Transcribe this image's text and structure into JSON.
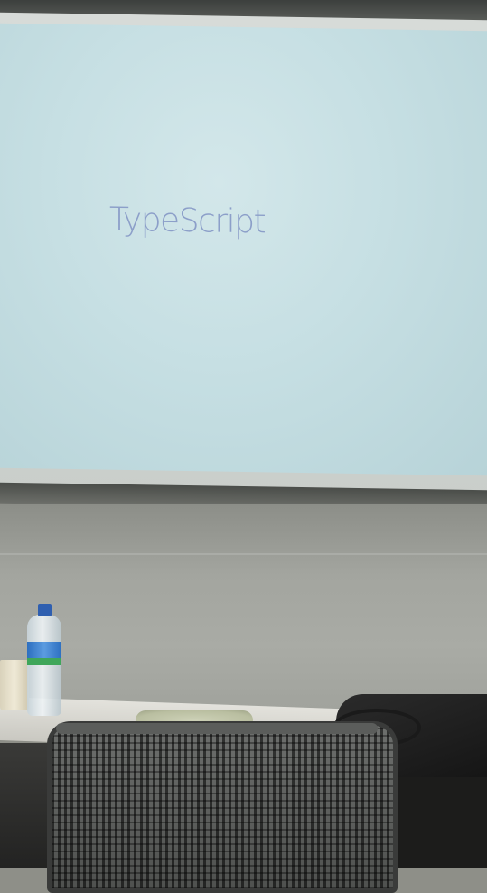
{
  "scene": {
    "projection_screen": {
      "title": "TypeScript"
    }
  }
}
